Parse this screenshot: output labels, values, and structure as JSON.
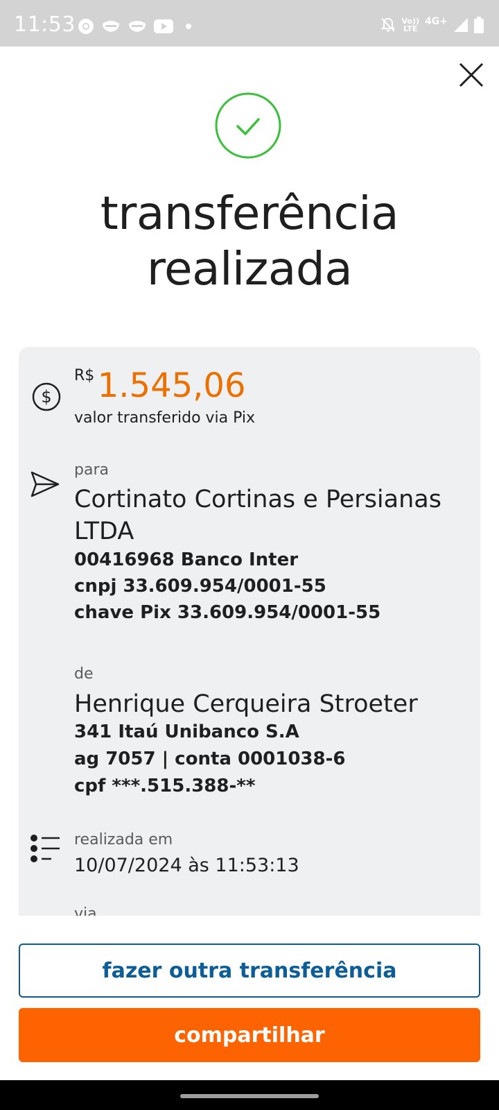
{
  "status_bar": {
    "time": "11:53",
    "network_label_top": "Vo))",
    "network_label_bottom": "LTE",
    "network_type": "4G+"
  },
  "title": {
    "line1": "transferência",
    "line2": "realizada"
  },
  "amount": {
    "currency": "R$",
    "value": "1.545,06",
    "description": "valor transferido via Pix"
  },
  "recipient": {
    "label": "para",
    "name": "Cortinato Cortinas e Persianas LTDA",
    "bank": "00416968 Banco Inter",
    "document": "cnpj 33.609.954/0001-55",
    "pix_key": "chave Pix 33.609.954/0001-55"
  },
  "sender": {
    "label": "de",
    "name": "Henrique Cerqueira Stroeter",
    "bank": "341 Itaú Unibanco S.A",
    "account": "ag 7057 | conta 0001038-6",
    "document": "cpf ***.515.388-**"
  },
  "date": {
    "label": "realizada em",
    "value": "10/07/2024 às 11:53:13"
  },
  "partial_next_label": "via",
  "buttons": {
    "new_transfer": "fazer outra transferência",
    "share": "compartilhar"
  },
  "colors": {
    "accent_orange": "#ec7000",
    "button_orange": "#fe6301",
    "link_blue": "#0d5d96",
    "success_green": "#3bbf3b",
    "card_bg": "#eff0f2"
  }
}
